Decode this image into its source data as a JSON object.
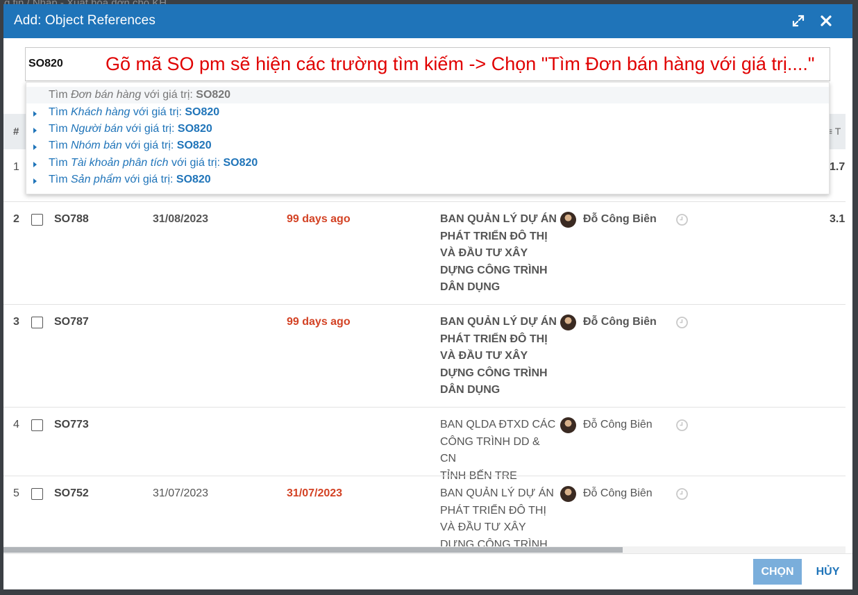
{
  "background_crumb": "g tin / Nhập - Xuất hóa đơn cho KH",
  "modal": {
    "title": "Add: Object References",
    "expand_icon": "expand-arrows-icon",
    "close_icon": "close-x-icon"
  },
  "search": {
    "value": "SO820"
  },
  "annotation": "Gõ mã SO pm sẽ hiện các trường tìm kiếm -> Chọn \"Tìm Đơn bán hàng với giá trị....\"",
  "dropdown": [
    {
      "prefix": "Tìm ",
      "field": "Đơn bán hàng",
      "mid": " với giá trị: ",
      "value": "SO820"
    },
    {
      "prefix": "Tìm ",
      "field": "Khách hàng",
      "mid": " với giá trị: ",
      "value": "SO820"
    },
    {
      "prefix": "Tìm ",
      "field": "Người bán",
      "mid": " với giá trị: ",
      "value": "SO820"
    },
    {
      "prefix": "Tìm ",
      "field": "Nhóm bán",
      "mid": " với giá trị: ",
      "value": "SO820"
    },
    {
      "prefix": "Tìm ",
      "field": "Tài khoản phân tích",
      "mid": " với giá trị: ",
      "value": "SO820"
    },
    {
      "prefix": "Tìm ",
      "field": "Sản phẩm",
      "mid": " với giá trị: ",
      "value": "SO820"
    }
  ],
  "table": {
    "header_hash": "#",
    "header_right": "≡ T",
    "rows": [
      {
        "idx": "1",
        "amount": "1.7"
      },
      {
        "idx": "2",
        "code": "SO788",
        "date": "31/08/2023",
        "due": "99 days ago",
        "customer": [
          "BAN QUẢN LÝ DỰ ÁN",
          "PHÁT TRIỂN ĐÔ THỊ",
          "VÀ ĐẦU TƯ XÂY",
          "DỰNG CÔNG TRÌNH",
          "DÂN DỤNG"
        ],
        "salesperson": "Đỗ Công Biên",
        "amount": "3.1",
        "bold": true
      },
      {
        "idx": "3",
        "code": "SO787",
        "date": "",
        "due": "99 days ago",
        "customer": [
          "BAN QUẢN LÝ DỰ ÁN",
          "PHÁT TRIỂN ĐÔ THỊ",
          "VÀ ĐẦU TƯ XÂY",
          "DỰNG CÔNG TRÌNH",
          "DÂN DỤNG"
        ],
        "salesperson": "Đỗ Công Biên",
        "amount": "",
        "bold": true
      },
      {
        "idx": "4",
        "code": "SO773",
        "date": "",
        "due": "",
        "customer": [
          "BAN QLDA ĐTXD CÁC",
          "CÔNG TRÌNH DD & CN",
          "TỈNH BẾN TRE"
        ],
        "salesperson": "Đỗ Công Biên",
        "amount": "",
        "bold": false
      },
      {
        "idx": "5",
        "code": "SO752",
        "date": "31/07/2023",
        "due": "31/07/2023",
        "customer": [
          "BAN QUẢN LÝ DỰ ÁN",
          "PHÁT TRIỂN ĐÔ THỊ",
          "VÀ ĐẦU TƯ XÂY",
          "DỰNG CÔNG TRÌNH"
        ],
        "salesperson": "Đỗ Công Biên",
        "amount": "",
        "bold": false
      }
    ]
  },
  "footer": {
    "choose_label": "CHỌN",
    "cancel_label": "HỦY"
  },
  "colors": {
    "header": "#1f74b9",
    "overdue": "#d34224",
    "annotation": "#e00000"
  }
}
